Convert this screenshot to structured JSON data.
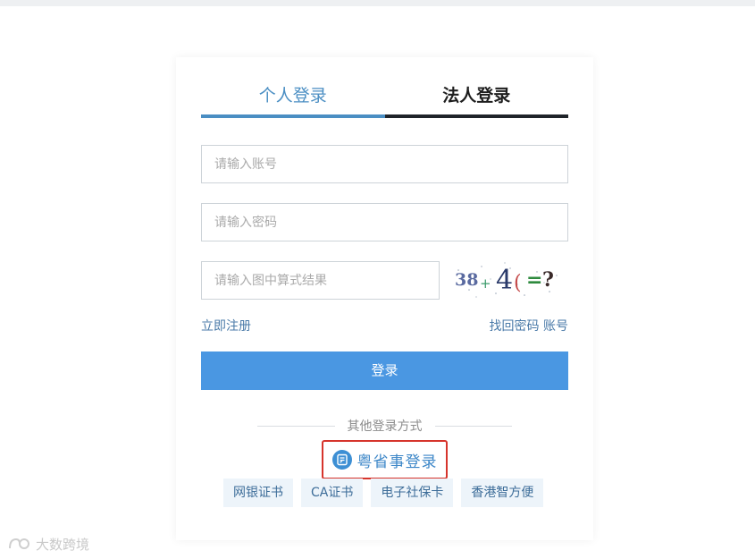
{
  "tabs": [
    {
      "label": "个人登录",
      "active": true
    },
    {
      "label": "法人登录",
      "active": false
    }
  ],
  "form": {
    "account_placeholder": "请输入账号",
    "password_placeholder": "请输入密码",
    "captcha_placeholder": "请输入图中算式结果",
    "captcha_text": "38+4(=?"
  },
  "links": {
    "register": "立即注册",
    "recover": "找回密码 账号"
  },
  "login_button": "登录",
  "other_methods": {
    "label": "其他登录方式",
    "highlighted": {
      "label": "粤省事登录",
      "icon": "yueshengshi-icon"
    },
    "items": [
      "网银证书",
      "CA证书",
      "电子社保卡",
      "香港智方便"
    ]
  },
  "watermark": "大数跨境",
  "colors": {
    "accent": "#4a8ec3",
    "button": "#4a97e2",
    "highlight_border": "#d6342c",
    "method_bg": "#edf4fa"
  }
}
